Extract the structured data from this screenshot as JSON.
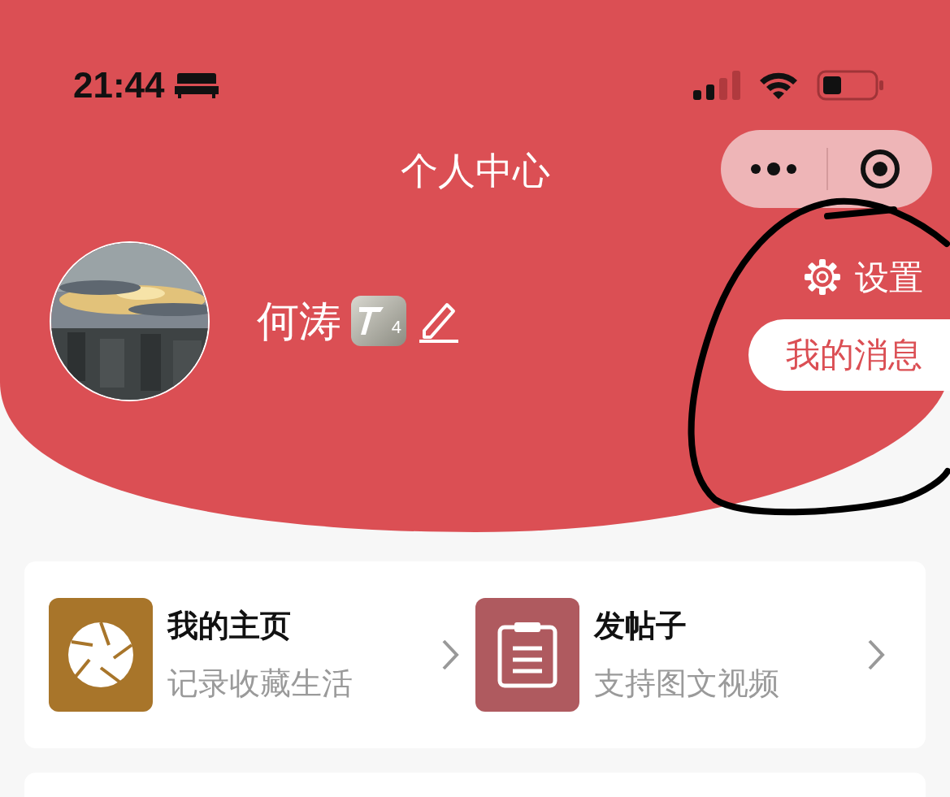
{
  "status_bar": {
    "time": "21:44"
  },
  "nav_bar": {
    "title": "个人中心"
  },
  "profile": {
    "name": "何涛",
    "level_badge": "4"
  },
  "side_actions": {
    "settings": "设置",
    "messages": "我的消息"
  },
  "shortcuts": [
    {
      "kind": "aperture",
      "title": "我的主页",
      "subtitle": "记录收藏生活",
      "color": "#a8752a"
    },
    {
      "kind": "clipboard",
      "title": "发帖子",
      "subtitle": "支持图文视频",
      "color": "#af5a5f"
    }
  ]
}
